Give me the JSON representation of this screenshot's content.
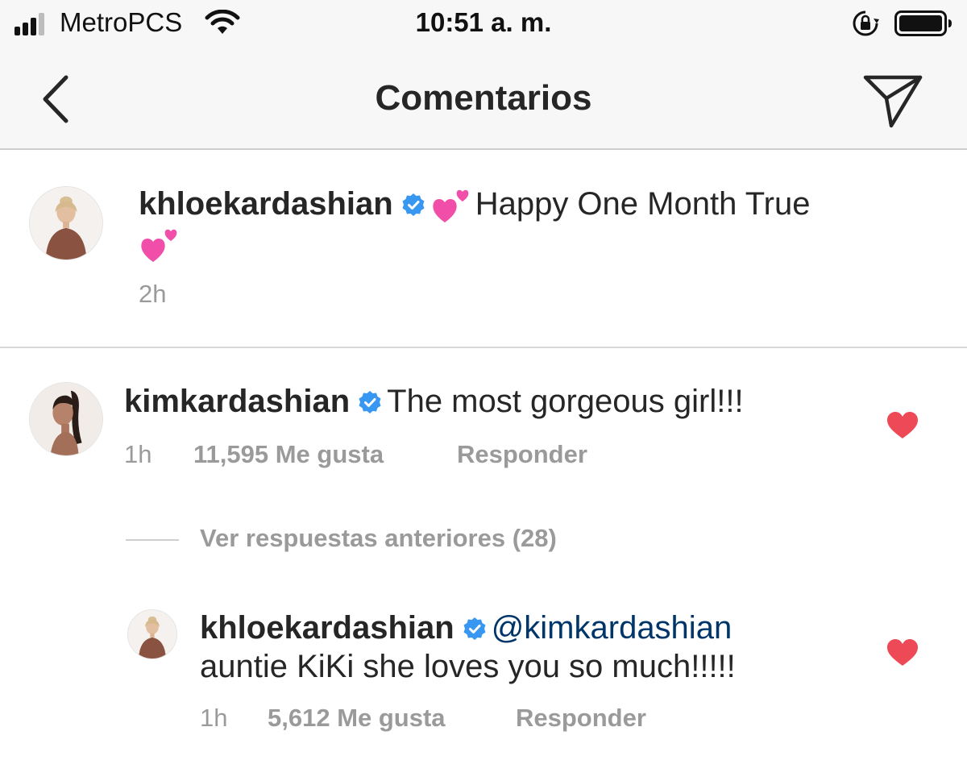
{
  "status_bar": {
    "carrier": "MetroPCS",
    "time": "10:51 a. m."
  },
  "nav": {
    "title": "Comentarios"
  },
  "caption": {
    "username": "khloekardashian",
    "text": "Happy One Month True",
    "time": "2h"
  },
  "comments": [
    {
      "username": "kimkardashian",
      "text": "The most gorgeous girl!!!",
      "time": "1h",
      "likes": "11,595 Me gusta",
      "reply_label": "Responder",
      "liked": true
    }
  ],
  "view_replies": {
    "label": "Ver respuestas anteriores (28)"
  },
  "reply": {
    "username": "khloekardashian",
    "mention": "@kimkardashian",
    "text": "auntie KiKi she loves you so much!!!!!",
    "time": "1h",
    "likes": "5,612 Me gusta",
    "reply_label": "Responder",
    "liked": true
  },
  "colors": {
    "verified": "#3897f0",
    "heart": "#ed4956",
    "mention": "#003569",
    "muted": "#9a9a9a",
    "bar_bg": "#f7f7f7"
  },
  "icons": [
    "signal-icon",
    "wifi-icon",
    "rotation-lock-icon",
    "battery-icon",
    "back-chevron-icon",
    "direct-send-icon",
    "verified-badge-icon",
    "two-hearts-emoji",
    "heart-icon"
  ]
}
